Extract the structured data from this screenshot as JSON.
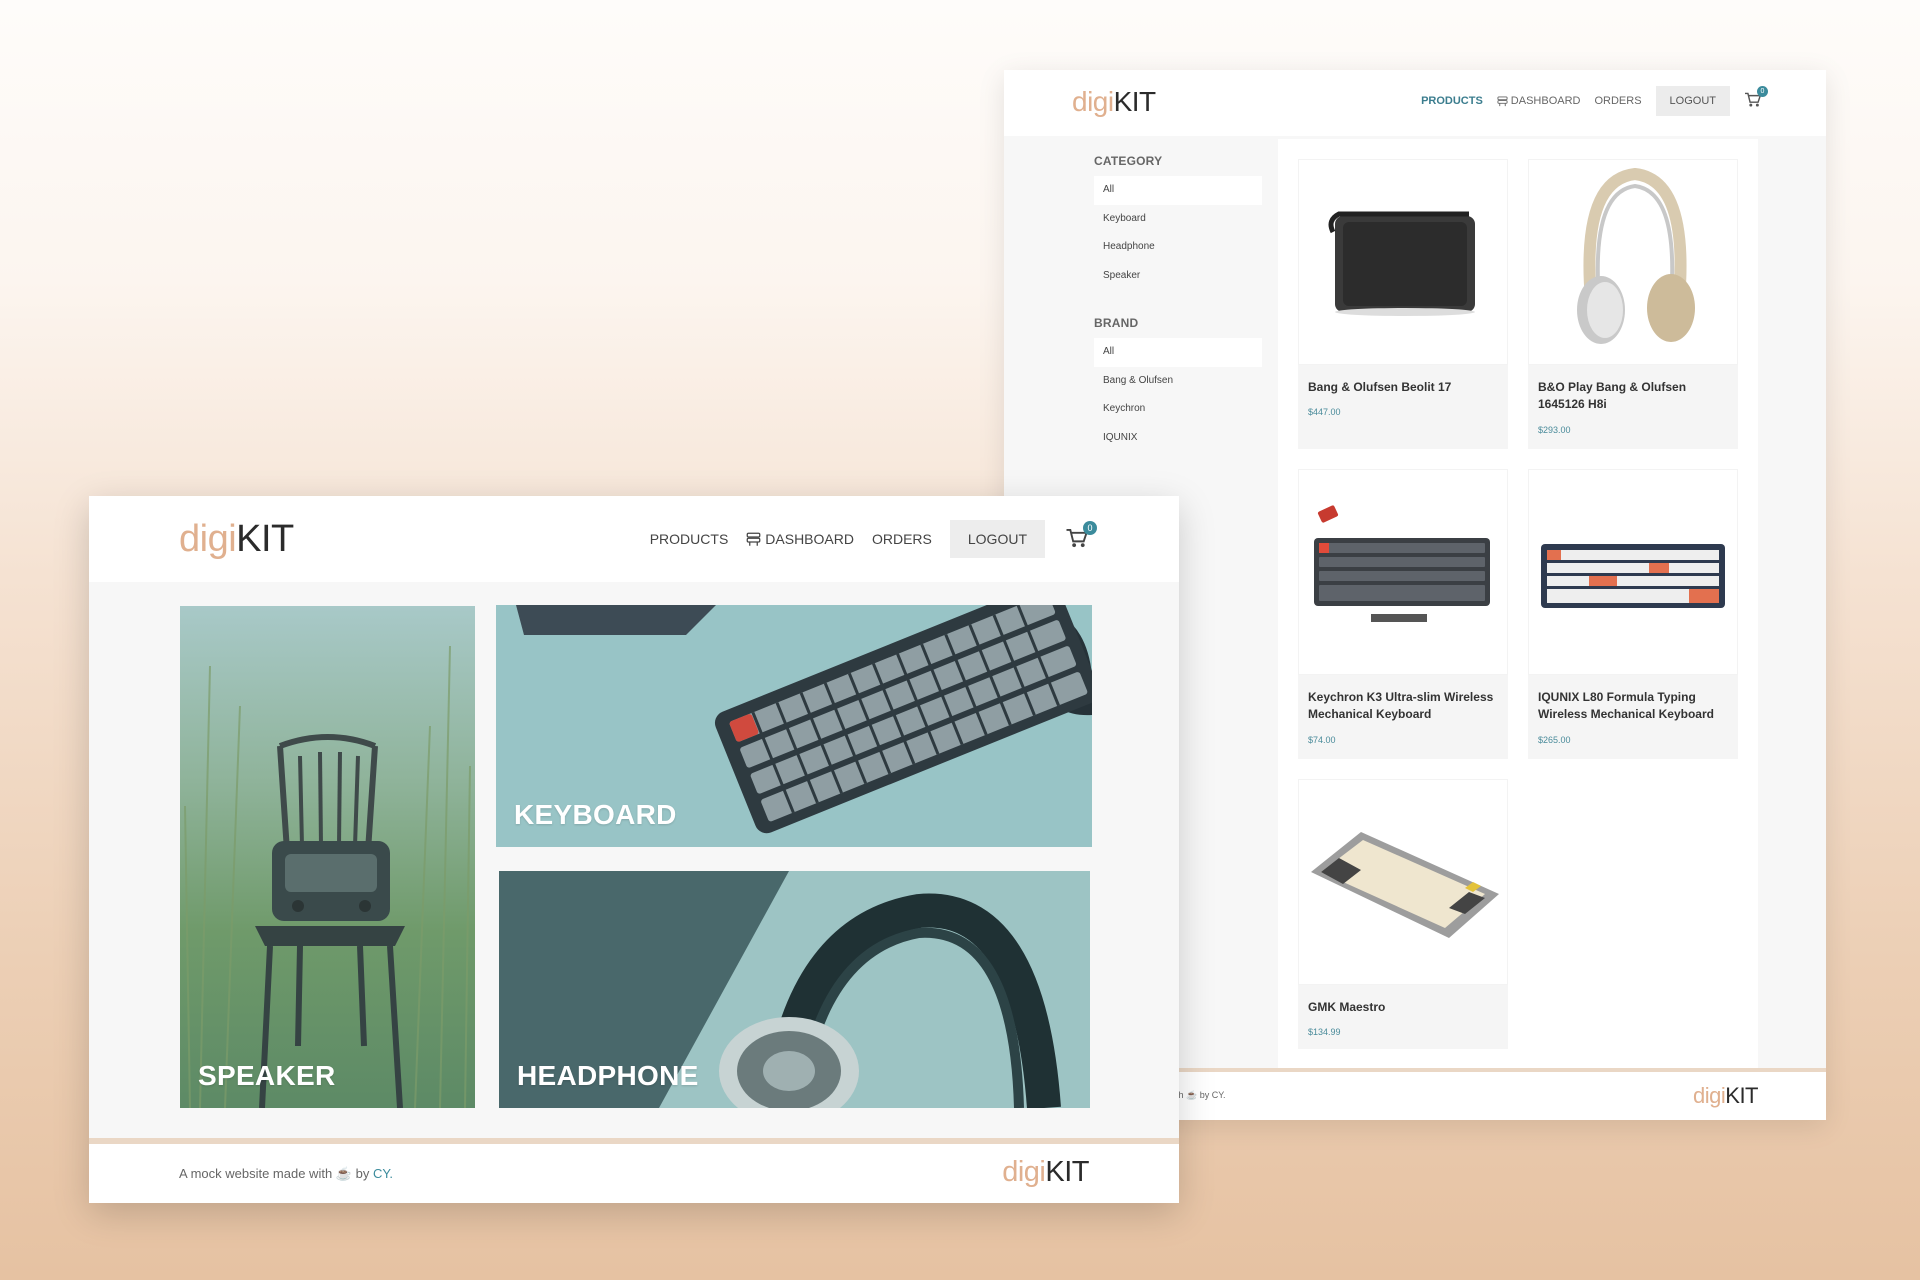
{
  "brand": {
    "logo_digi": "digi",
    "logo_kit": "KIT"
  },
  "products_page": {
    "nav": {
      "products": "PRODUCTS",
      "dashboard": "DASHBOARD",
      "orders": "ORDERS",
      "logout": "LOGOUT",
      "cart_count": "0",
      "cart_icon": "cart-icon",
      "dashboard_icon": "database-icon"
    },
    "sidebar": {
      "category_title": "CATEGORY",
      "categories": [
        "All",
        "Keyboard",
        "Headphone",
        "Speaker"
      ],
      "brand_title": "BRAND",
      "brands": [
        "All",
        "Bang & Olufsen",
        "Keychron",
        "IQUNIX"
      ]
    },
    "products": [
      {
        "name": "Bang & Olufsen Beolit 17",
        "price": "$447.00"
      },
      {
        "name": "B&O Play Bang & Olufsen 1645126 H8i",
        "price": "$293.00"
      },
      {
        "name": "Keychron K3 Ultra-slim Wireless Mechanical Keyboard",
        "price": "$74.00"
      },
      {
        "name": "IQUNIX L80 Formula Typing Wireless Mechanical Keyboard",
        "price": "$265.00"
      },
      {
        "name": "GMK Maestro",
        "price": "$134.99"
      }
    ],
    "footer": {
      "credit_text": "ith ☕ by CY."
    }
  },
  "home_page": {
    "nav": {
      "products": "PRODUCTS",
      "dashboard": "DASHBOARD",
      "orders": "ORDERS",
      "logout": "LOGOUT",
      "cart_count": "0"
    },
    "tiles": {
      "speaker": "SPEAKER",
      "keyboard": "KEYBOARD",
      "headphone": "HEADPHONE"
    },
    "footer": {
      "credit_prefix": "A mock website made with ☕ by ",
      "credit_link": "CY."
    }
  },
  "colors": {
    "accent_teal": "#3b8b9c",
    "logo_digi": "#e0b08f",
    "footer_rule": "#ead7c5"
  }
}
